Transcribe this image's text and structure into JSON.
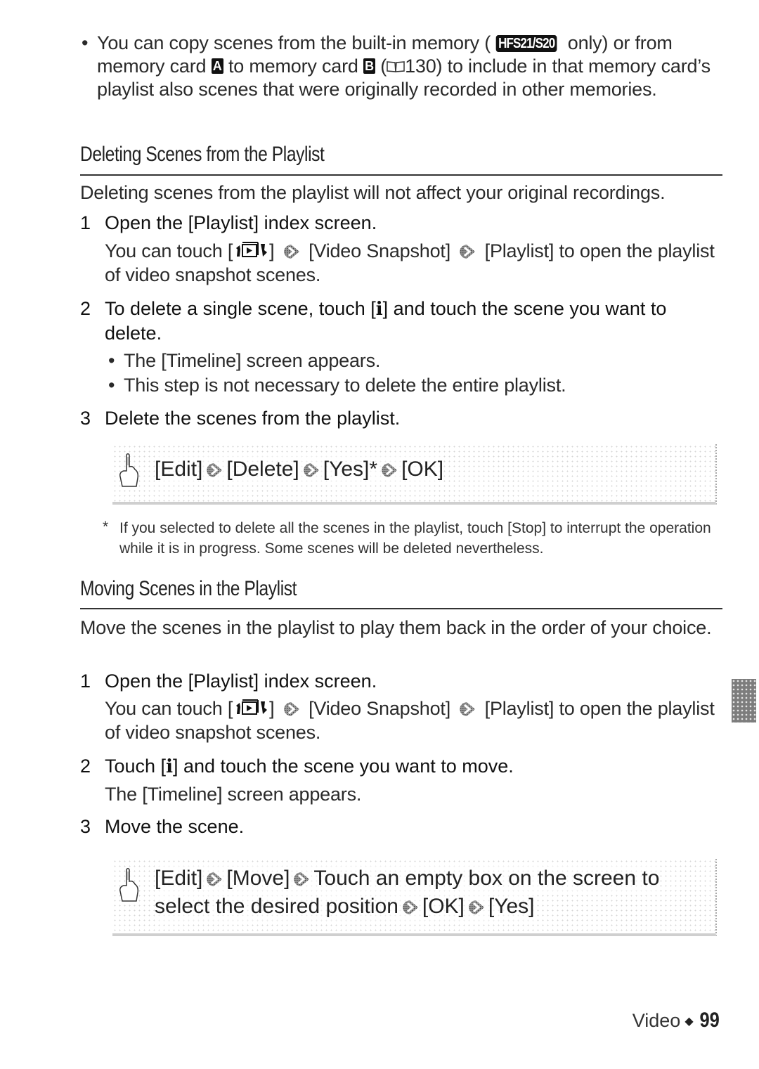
{
  "intro_bullet": {
    "part1": "You can copy scenes from the built-in memory (",
    "model_badge": "HFS21/S20",
    "part2": " only) or from memory card ",
    "card_a": "A",
    "part3": " to memory card ",
    "card_b": "B",
    "part4": " (",
    "page_ref": "130",
    "part5": ") to include in that memory card’s playlist also scenes that were originally recorded in other memories."
  },
  "delete_section": {
    "title": "Deleting Scenes from the Playlist",
    "intro": "Deleting scenes from the playlist will not affect your original recordings.",
    "steps": [
      {
        "num": "1",
        "text": "Open the [Playlist] index screen.",
        "detail_a": "You can touch [",
        "detail_b": "] ",
        "detail_c": " [Video Snapshot] ",
        "detail_d": " [Playlist] to open the playlist of video snapshot scenes."
      },
      {
        "num": "2",
        "text_a": "To delete a single scene, touch [",
        "icon": "i",
        "text_b": "] and touch the scene you want to delete.",
        "bullets": [
          "The [Timeline] screen appears.",
          "This step is not necessary to delete the entire playlist."
        ]
      },
      {
        "num": "3",
        "text": "Delete the scenes from the playlist."
      }
    ],
    "procedure": [
      "[Edit]",
      "[Delete]",
      "[Yes]*",
      "[OK]"
    ],
    "footnote": "If you selected to delete all the scenes in the playlist, touch [Stop] to interrupt the operation while it is in progress. Some scenes will be deleted nevertheless."
  },
  "move_section": {
    "title": "Moving Scenes in the Playlist",
    "intro": "Move the scenes in the playlist to play them back in the order of your choice.",
    "steps": [
      {
        "num": "1",
        "text": "Open the [Playlist] index screen.",
        "detail_a": "You can touch [",
        "detail_b": "] ",
        "detail_c": " [Video Snapshot] ",
        "detail_d": " [Playlist] to open the playlist of video snapshot scenes."
      },
      {
        "num": "2",
        "text_a": "Touch [",
        "icon": "i",
        "text_b": "] and touch the scene you want to move.",
        "detail": "The [Timeline] screen appears."
      },
      {
        "num": "3",
        "text": "Move the scene."
      }
    ],
    "procedure_line1": [
      "[Edit]",
      "[Move]",
      "Touch an empty box on the screen to"
    ],
    "procedure_line2": [
      "select the desired position",
      "[OK]",
      "[Yes]"
    ]
  },
  "footer": {
    "section": "Video",
    "separator": "◆",
    "page": "99"
  },
  "symbols": {
    "bullet": "•",
    "asterisk": "*"
  }
}
